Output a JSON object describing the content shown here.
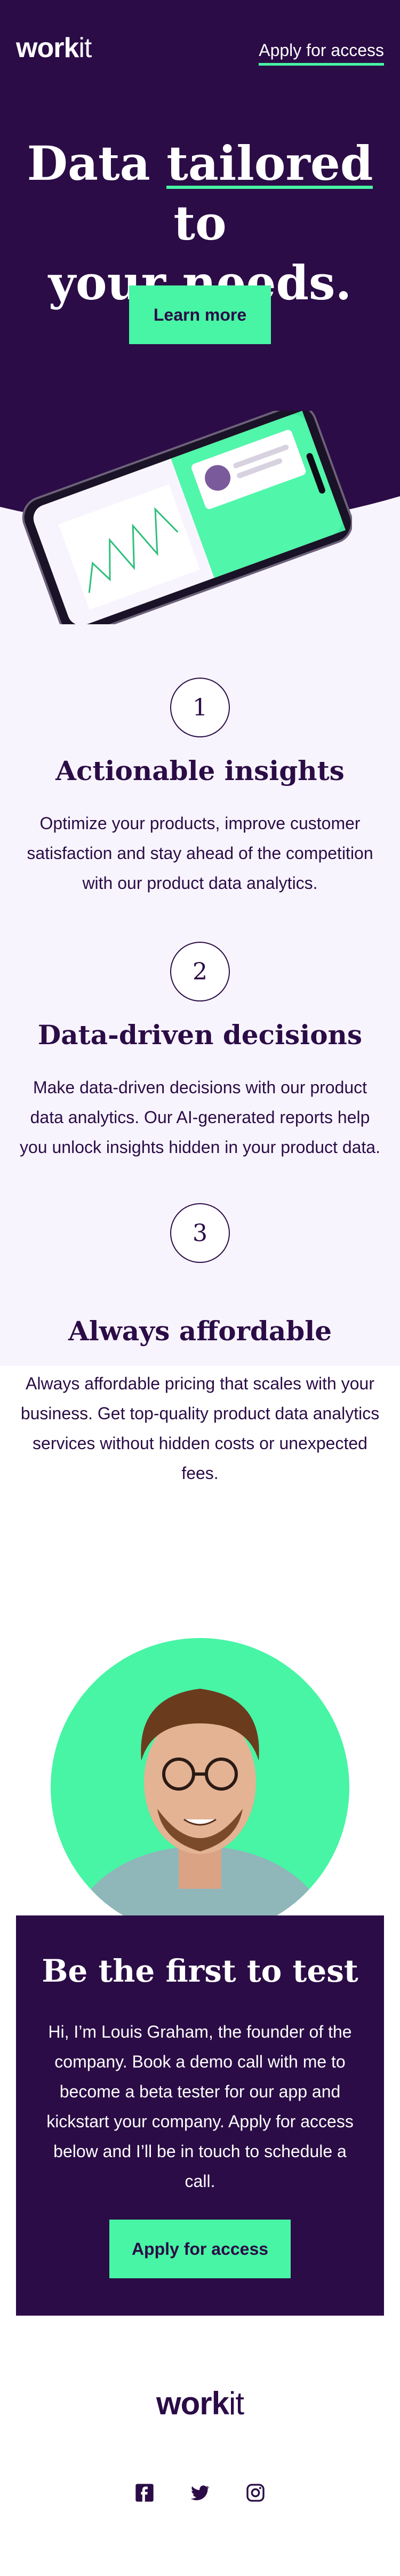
{
  "header": {
    "logo_main": "work",
    "logo_accent": "it",
    "apply_label": "Apply for access"
  },
  "hero": {
    "title_part1": "Data ",
    "title_highlight": "tailored",
    "title_part2": " to",
    "title_line2": "your needs.",
    "cta_label": "Learn more"
  },
  "features": [
    {
      "number": "1",
      "title": "Actionable insights",
      "body": "Optimize your products, improve customer satisfaction and stay ahead of the competition with our product data analytics."
    },
    {
      "number": "2",
      "title": "Data-driven decisions",
      "body": "Make data-driven decisions with our product data analytics. Our AI-generated reports help you unlock insights hidden in your product data."
    },
    {
      "number": "3",
      "title": "Always affordable",
      "body": "Always affordable pricing that scales with your business. Get top-quality product data analytics services without hidden costs or unexpected fees."
    }
  ],
  "tester": {
    "title": "Be the first to test",
    "body": "Hi, I’m Louis Graham, the founder of the company. Book a demo call with me to become a beta tester for our app and kickstart your company. Apply for access below and I’ll be in touch to schedule a call.",
    "cta_label": "Apply for access"
  },
  "footer": {
    "logo_main": "work",
    "logo_accent": "it",
    "socials": [
      "facebook-icon",
      "twitter-icon",
      "instagram-icon"
    ]
  },
  "colors": {
    "brand_purple": "#2b0c46",
    "accent_green": "#47f5a4",
    "feature_bg": "#f8f4fe"
  }
}
